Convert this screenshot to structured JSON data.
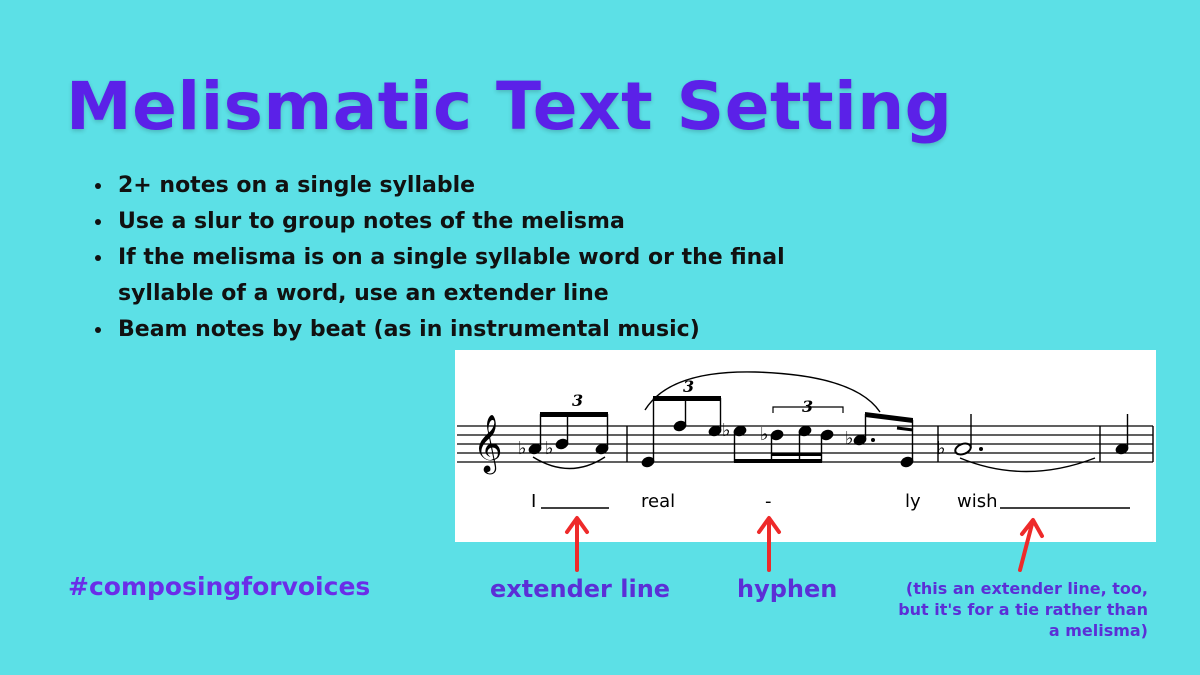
{
  "slide": {
    "title": "Melismatic Text Setting",
    "bullets": [
      "2+ notes on a single syllable",
      "Use a slur to group notes of the melisma",
      "If the melisma is on a single syllable word or the final syllable of a word, use an extender line",
      "Beam notes by beat (as in instrumental music)"
    ],
    "hashtag": "#composingforvoices",
    "colors": {
      "background": "#5ce0e6",
      "title": "#5b21e8",
      "annotation": "#5b2fd6",
      "arrow": "#ee2a2a"
    }
  },
  "score": {
    "tuplet_label": "3",
    "lyrics": {
      "word_1": "I",
      "word_2": "real",
      "hyphen": "-",
      "word_3": "ly",
      "word_4": "wish"
    }
  },
  "annotations": {
    "extender": "extender line",
    "hyphen": "hyphen",
    "tie_note": "(this an extender line, too, but it's for a tie rather than a melisma)"
  }
}
